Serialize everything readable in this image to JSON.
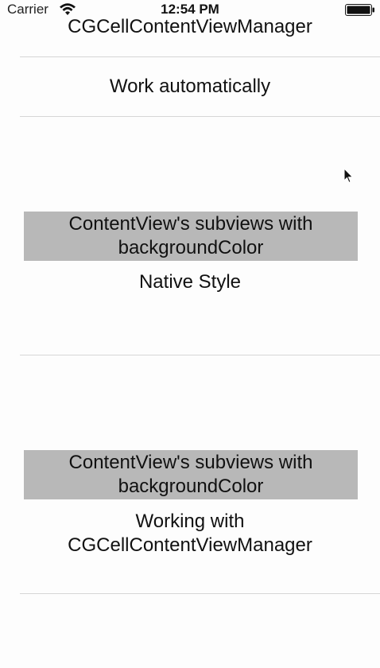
{
  "status_bar": {
    "carrier": "Carrier",
    "time": "12:54 PM"
  },
  "header": {
    "title": "CGCellContentViewManager"
  },
  "cells": {
    "work_auto": {
      "label": "Work automatically"
    },
    "native": {
      "box_text": "ContentView's subviews with backgroundColor",
      "caption": "Native Style"
    },
    "manager": {
      "box_text": "ContentView's subviews with backgroundColor",
      "caption": "Working with CGCellContentViewManager"
    }
  },
  "colors": {
    "background": "#fdfdfd",
    "separator": "#d6d6d6",
    "grey_box": "#b8b8b8",
    "text": "#111111"
  },
  "icons": [
    "wifi-icon",
    "battery-icon",
    "cursor-icon"
  ]
}
